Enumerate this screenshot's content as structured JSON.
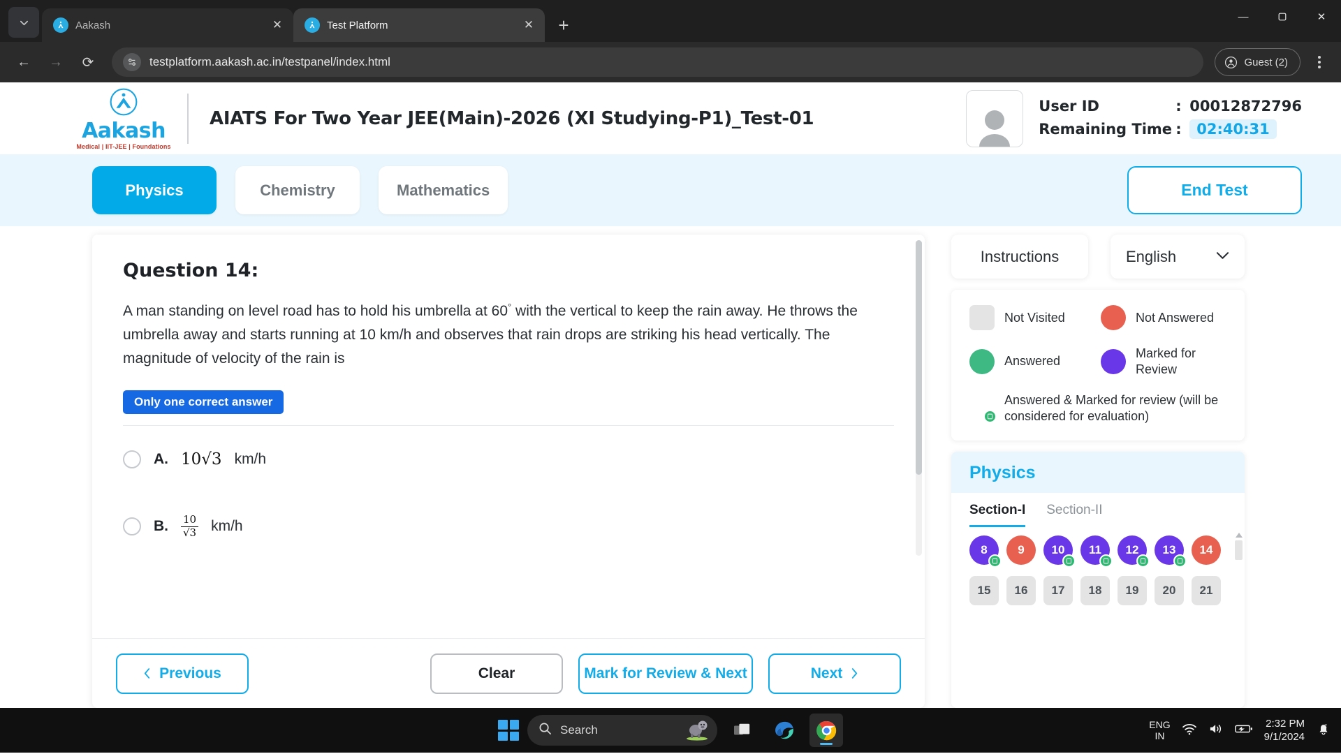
{
  "browser": {
    "tab_search_icon": "chevron-down-icon",
    "tabs": [
      {
        "title": "Aakash",
        "favicon": "aakash-favicon",
        "close": "✕"
      },
      {
        "title": "Test Platform",
        "favicon": "aakash-favicon",
        "close": "✕"
      }
    ],
    "new_tab_label": "+",
    "window_controls": {
      "minimize": "—",
      "maximize": "❐",
      "close": "✕"
    },
    "back_icon": "←",
    "forward_icon": "→",
    "reload_icon": "⟳",
    "url": "testplatform.aakash.ac.in/testpanel/index.html",
    "site_info_icon": "tune-icon",
    "profile_label": "Guest (2)",
    "menu_icon": "kebab-menu-icon"
  },
  "header": {
    "brand_name": "Aakash",
    "brand_tagline": "Medical | IIT-JEE | Foundations",
    "test_title": "AIATS For Two Year JEE(Main)-2026 (XI Studying-P1)_Test-01",
    "user_id_label": "User ID",
    "user_id_sep": ":",
    "user_id_value": "00012872796",
    "remaining_time_label": "Remaining Time",
    "remaining_time_sep": ":",
    "remaining_time_value": "02:40:31"
  },
  "subject_bar": {
    "tabs": [
      {
        "label": "Physics",
        "active": true
      },
      {
        "label": "Chemistry",
        "active": false
      },
      {
        "label": "Mathematics",
        "active": false
      }
    ],
    "end_test_label": "End Test"
  },
  "question": {
    "title": "Question 14:",
    "text_part1": "A man standing on level road has to hold his umbrella at 60",
    "text_sup": "°",
    "text_part2": " with the vertical to keep the rain away. He throws the umbrella away and starts running at 10 km/h and observes that rain drops are striking his head vertically. The magnitude of velocity of the rain is",
    "badge": "Only one correct answer",
    "options": [
      {
        "letter": "A.",
        "value": "10√3",
        "unit": "km/h",
        "selected": false
      },
      {
        "letter": "B.",
        "num": "10",
        "den": "√3",
        "unit": "km/h",
        "selected": false
      }
    ]
  },
  "footer": {
    "previous_label": "Previous",
    "previous_icon": "chevron-left-icon",
    "clear_label": "Clear",
    "mark_review_label": "Mark for Review & Next",
    "next_label": "Next",
    "next_icon": "chevron-right-icon"
  },
  "right_panel": {
    "instructions_label": "Instructions",
    "language_label": "English",
    "language_chevron": "chevron-down-icon",
    "legend": [
      {
        "label": "Not Visited",
        "shape": "square",
        "color": "#e4e4e4"
      },
      {
        "label": "Not Answered",
        "shape": "circle",
        "color": "#e8604f"
      },
      {
        "label": "Answered",
        "shape": "circle",
        "color": "#3fb984"
      },
      {
        "label": "Marked for Review",
        "shape": "circle",
        "color": "#6936e8"
      }
    ],
    "legend_wide": {
      "label": "Answered & Marked for review (will be considered for evaluation)",
      "color": "#6936e8",
      "badge_color": "#2eb872",
      "badge_icon": "document-icon"
    },
    "palette_title": "Physics",
    "sections": [
      {
        "label": "Section-I",
        "active": true
      },
      {
        "label": "Section-II",
        "active": false
      }
    ],
    "questions": [
      {
        "n": "8",
        "state": "purple",
        "badge": true
      },
      {
        "n": "9",
        "state": "red",
        "badge": false
      },
      {
        "n": "10",
        "state": "purple",
        "badge": true
      },
      {
        "n": "11",
        "state": "purple",
        "badge": true
      },
      {
        "n": "12",
        "state": "purple",
        "badge": true
      },
      {
        "n": "13",
        "state": "purple",
        "badge": true
      },
      {
        "n": "14",
        "state": "red",
        "badge": false
      },
      {
        "n": "15",
        "state": "gray",
        "badge": false
      },
      {
        "n": "16",
        "state": "gray",
        "badge": false
      },
      {
        "n": "17",
        "state": "gray",
        "badge": false
      },
      {
        "n": "18",
        "state": "gray",
        "badge": false
      },
      {
        "n": "19",
        "state": "gray",
        "badge": false
      },
      {
        "n": "20",
        "state": "gray",
        "badge": false
      },
      {
        "n": "21",
        "state": "gray",
        "badge": false
      }
    ]
  },
  "taskbar": {
    "start_icon": "windows-start-icon",
    "search_placeholder": "Search",
    "search_icon": "search-icon",
    "search_illustration": "gorilla-icon",
    "taskview_icon": "task-view-icon",
    "edge_icon": "edge-icon",
    "chrome_icon": "chrome-icon",
    "language": "ENG",
    "language_sub": "IN",
    "wifi_icon": "wifi-icon",
    "volume_icon": "volume-icon",
    "battery_icon": "battery-charging-icon",
    "time": "2:32 PM",
    "date": "9/1/2024",
    "notification_icon": "notification-bell-dnd-icon"
  }
}
